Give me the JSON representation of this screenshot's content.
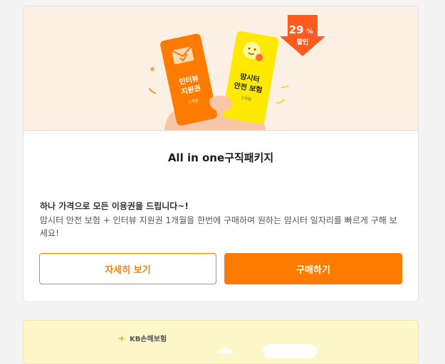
{
  "banner": {
    "discount_percent": "29",
    "discount_unit": "%",
    "discount_label": "할인",
    "card_orange": {
      "line1": "인터뷰",
      "line2": "지원권",
      "sub": "1개월"
    },
    "card_yellow": {
      "line1": "맘시터",
      "line2": "안전 보험",
      "sub": "3개월"
    }
  },
  "product": {
    "title": "All in one구직패키지",
    "headline": "하나 가격으로 모든 이용권을 드립니다~!",
    "description": "맘시터 안전 보험 + 인터뷰 지원권 1개월을 한번에 구매하여 원하는 맘시터 일자리를 빠르게 구해 보세요!"
  },
  "buttons": {
    "detail": "자세히 보기",
    "buy": "구매하기"
  },
  "next_card": {
    "logo_text": "KB손해보험"
  },
  "colors": {
    "accent": "#ff7b00",
    "banner_bg": "#fcefe4",
    "next_card_bg": "#fdf7c9"
  }
}
